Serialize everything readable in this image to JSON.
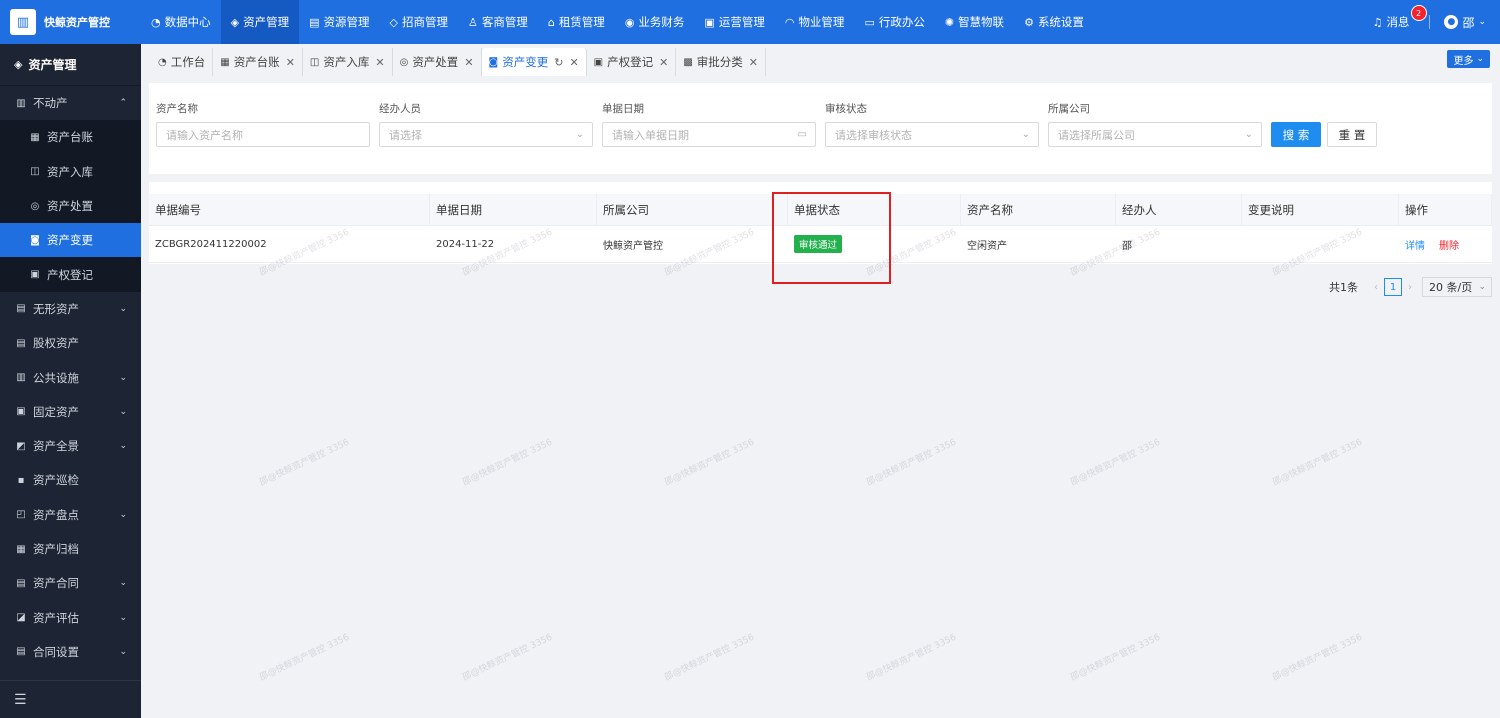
{
  "brand": {
    "name": "快鲸资产管控",
    "logo_icon": "building-icon"
  },
  "topnav": [
    {
      "label": "数据中心",
      "icon": "◔"
    },
    {
      "label": "资产管理",
      "icon": "◈",
      "active": true
    },
    {
      "label": "资源管理",
      "icon": "▤"
    },
    {
      "label": "招商管理",
      "icon": "◇"
    },
    {
      "label": "客商管理",
      "icon": "♙"
    },
    {
      "label": "租赁管理",
      "icon": "⌂"
    },
    {
      "label": "业务财务",
      "icon": "◉"
    },
    {
      "label": "运营管理",
      "icon": "▣"
    },
    {
      "label": "物业管理",
      "icon": "◠"
    },
    {
      "label": "行政办公",
      "icon": "▭"
    },
    {
      "label": "智慧物联",
      "icon": "✺"
    },
    {
      "label": "系统设置",
      "icon": "⚙"
    }
  ],
  "topright": {
    "message_label": "消息",
    "message_count": "2",
    "user_name": "邵"
  },
  "sidebar": {
    "header": "资产管理",
    "items": [
      {
        "label": "不动产",
        "icon": "▥",
        "arrow": "⌃"
      },
      {
        "label": "资产台账",
        "icon": "▦",
        "sub": true
      },
      {
        "label": "资产入库",
        "icon": "◫",
        "sub": true
      },
      {
        "label": "资产处置",
        "icon": "◎",
        "sub": true
      },
      {
        "label": "资产变更",
        "icon": "◙",
        "sub": true,
        "active": true
      },
      {
        "label": "产权登记",
        "icon": "▣",
        "sub": true
      },
      {
        "label": "无形资产",
        "icon": "▤",
        "arrow": "⌄"
      },
      {
        "label": "股权资产",
        "icon": "▤"
      },
      {
        "label": "公共设施",
        "icon": "▥",
        "arrow": "⌄"
      },
      {
        "label": "固定资产",
        "icon": "▣",
        "arrow": "⌄"
      },
      {
        "label": "资产全景",
        "icon": "◩",
        "arrow": "⌄"
      },
      {
        "label": "资产巡检",
        "icon": "▪"
      },
      {
        "label": "资产盘点",
        "icon": "◰",
        "arrow": "⌄"
      },
      {
        "label": "资产归档",
        "icon": "▦"
      },
      {
        "label": "资产合同",
        "icon": "▤",
        "arrow": "⌄"
      },
      {
        "label": "资产评估",
        "icon": "◪",
        "arrow": "⌄"
      },
      {
        "label": "合同设置",
        "icon": "▤",
        "arrow": "⌄"
      }
    ],
    "footer_icon": "☰"
  },
  "tabs": [
    {
      "label": "工作台",
      "icon": "◔",
      "closable": false
    },
    {
      "label": "资产台账",
      "icon": "▦",
      "closable": true
    },
    {
      "label": "资产入库",
      "icon": "◫",
      "closable": true
    },
    {
      "label": "资产处置",
      "icon": "◎",
      "closable": true
    },
    {
      "label": "资产变更",
      "icon": "◙",
      "closable": true,
      "active": true,
      "refresh": "↻"
    },
    {
      "label": "产权登记",
      "icon": "▣",
      "closable": true
    },
    {
      "label": "审批分类",
      "icon": "▩",
      "closable": true
    }
  ],
  "more_label": "更多",
  "search": {
    "fields": [
      {
        "label": "资产名称",
        "placeholder": "请输入资产名称",
        "suffix": ""
      },
      {
        "label": "经办人员",
        "placeholder": "请选择",
        "suffix": "⌄"
      },
      {
        "label": "单据日期",
        "placeholder": "请输入单据日期",
        "suffix": "▭"
      },
      {
        "label": "审核状态",
        "placeholder": "请选择审核状态",
        "suffix": "⌄"
      },
      {
        "label": "所属公司",
        "placeholder": "请选择所属公司",
        "suffix": "⌄"
      }
    ],
    "search_label": "搜 索",
    "reset_label": "重 置"
  },
  "table": {
    "columns": [
      "单据编号",
      "单据日期",
      "所属公司",
      "单据状态",
      "资产名称",
      "经办人",
      "变更说明",
      "操作"
    ],
    "rows": [
      {
        "code": "ZCBGR202411220002",
        "date": "2024-11-22",
        "company": "快鲸资产管控",
        "status": "审核通过",
        "asset": "空闲资产",
        "handler": "邵",
        "note": "",
        "detail": "详情",
        "delete": "删除"
      }
    ]
  },
  "pager": {
    "total": "共1条",
    "page": "1",
    "size": "20 条/页"
  },
  "watermark": "邵@快鲸资产管控 3356",
  "colors": {
    "primary": "#1f6fe0",
    "success": "#23b14d",
    "danger": "#f5222d",
    "sidebar": "#1d2433"
  }
}
